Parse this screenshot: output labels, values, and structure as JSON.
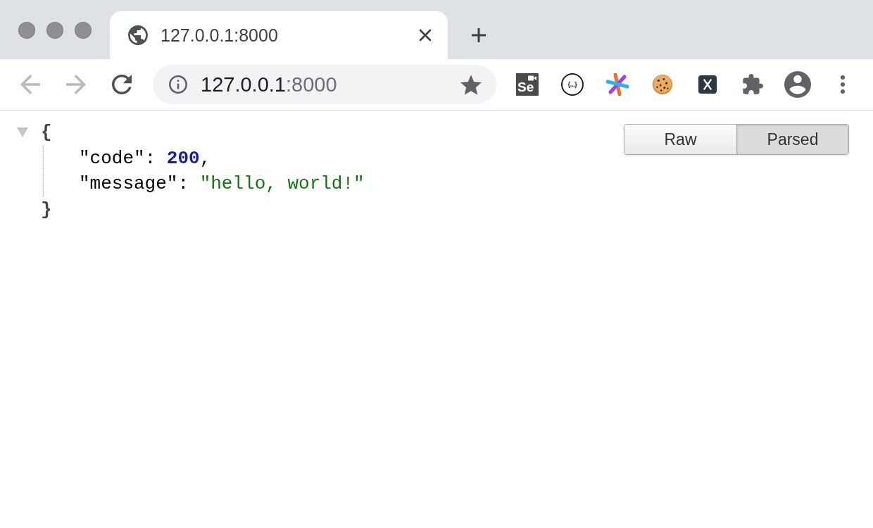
{
  "window": {
    "active": false
  },
  "tabs": [
    {
      "title": "127.0.0.1:8000",
      "selected": true
    }
  ],
  "toolbar": {
    "back": {
      "disabled": true
    },
    "forward": {
      "disabled": true
    },
    "address": {
      "host": "127.0.0.1",
      "port": ":8000"
    },
    "extensions": [
      {
        "kind": "tile",
        "label": "Se"
      },
      {
        "kind": "ring",
        "label": "{...}"
      },
      {
        "kind": "asterisk"
      },
      {
        "kind": "cookie"
      },
      {
        "kind": "cross"
      }
    ]
  },
  "json_viewer": {
    "modes": [
      {
        "label": "Raw",
        "selected": false
      },
      {
        "label": "Parsed",
        "selected": true
      }
    ],
    "expanded": true,
    "open": "{",
    "close": "}",
    "members": [
      {
        "key": "\"code\"",
        "colon": ":",
        "value": "200",
        "kind": "number",
        "comma": ","
      },
      {
        "key": "\"message\"",
        "colon": ":",
        "value": "\"hello, world!\"",
        "kind": "string"
      }
    ]
  }
}
